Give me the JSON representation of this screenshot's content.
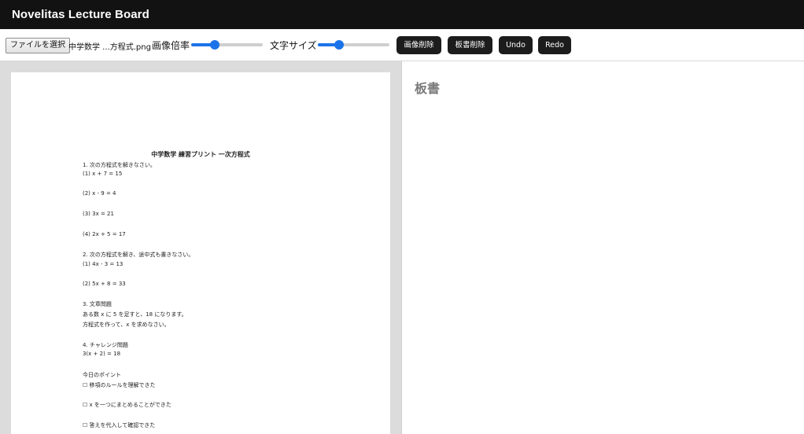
{
  "app": {
    "title": "Novelitas Lecture Board"
  },
  "toolbar": {
    "file_button_label": "ファイルを選択",
    "file_name": "中学数学 ...方程式.png",
    "image_scale_label": "画像倍率",
    "image_scale_value": 0.33,
    "text_size_label": "文字サイズ",
    "text_size_value": 0.3,
    "delete_image_label": "画像削除",
    "delete_board_label": "板書削除",
    "undo_label": "Undo",
    "redo_label": "Redo"
  },
  "worksheet": {
    "title": "中学数学 練習プリント 一次方程式",
    "lines": [
      "1. 次の方程式を解きなさい。",
      "(1) x + 7 = 15",
      "(2) x - 9 = 4",
      "(3) 3x = 21",
      "(4) 2x + 5 = 17",
      "2. 次の方程式を解き、途中式も書きなさい。",
      "(1) 4x - 3 = 13",
      "(2) 5x + 8 = 33",
      "3. 文章問題",
      "ある数 x に 5 を足すと、18 になります。",
      "方程式を作って、x を求めなさい。",
      "4. チャレンジ問題",
      "3(x + 2) = 18",
      "今日のポイント",
      "☐ 移項のルールを理解できた",
      "☐ x を一つにまとめることができた",
      "☐ 答えを代入して確認できた"
    ]
  },
  "board": {
    "title": "板書"
  },
  "colors": {
    "header_bg": "#121212",
    "button_bg": "#1c1c1c",
    "slider_accent": "#1a73e8",
    "image_pane_bg": "#dcdcdc",
    "board_title_color": "#7a7a7a"
  }
}
